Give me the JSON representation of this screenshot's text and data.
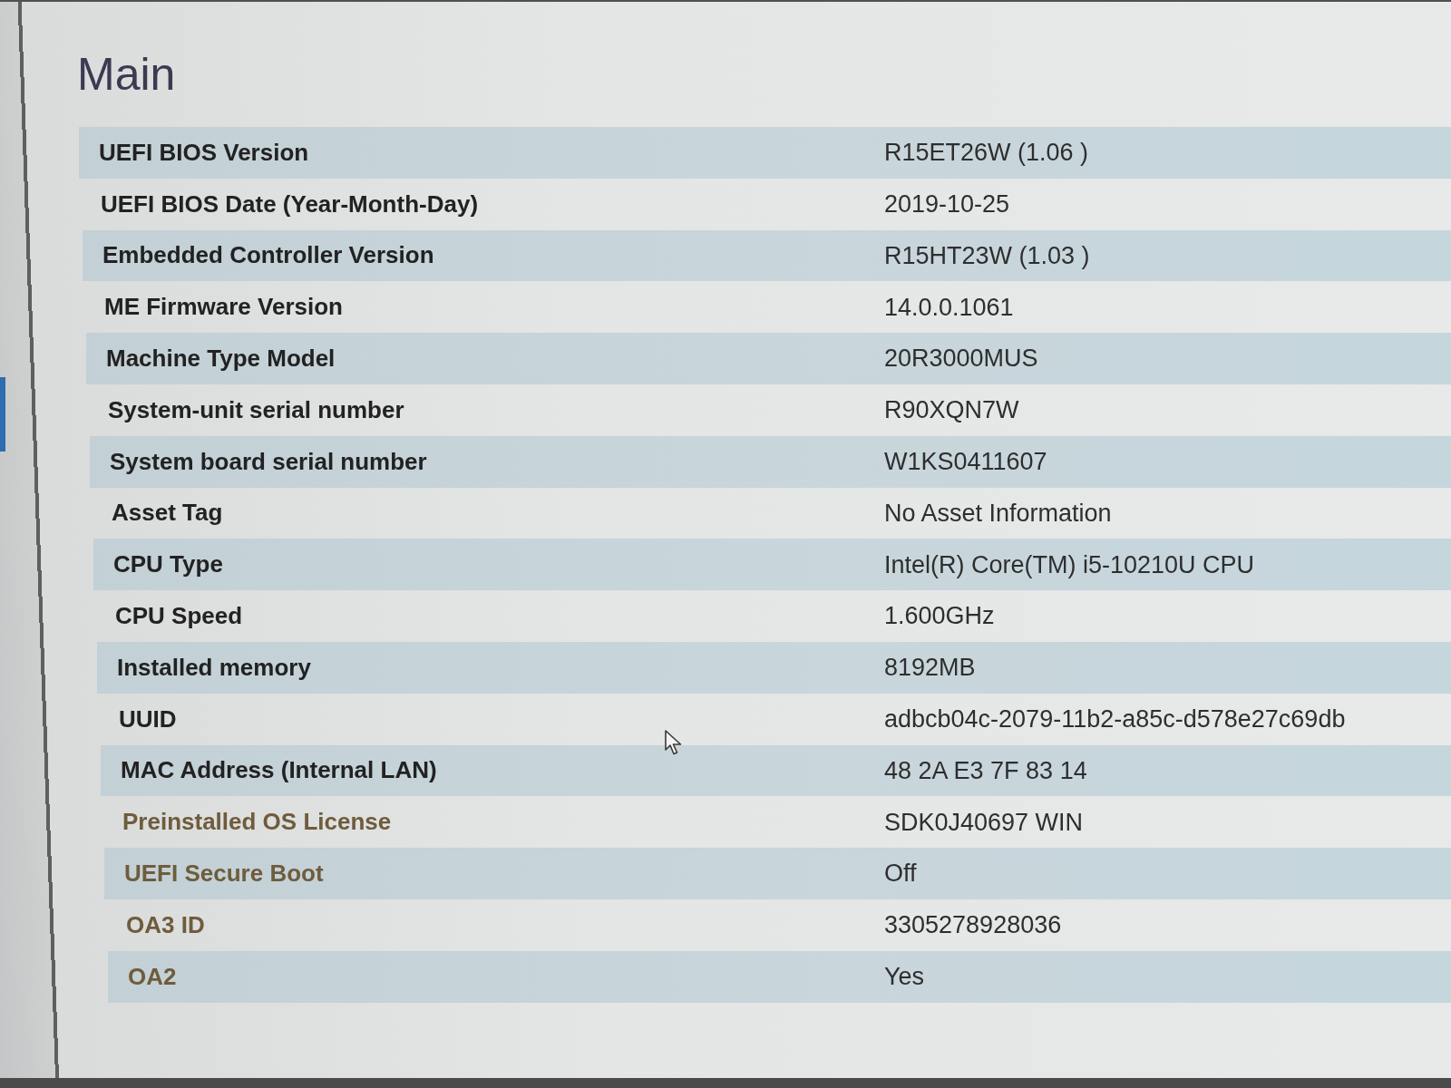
{
  "page": {
    "title": "Main"
  },
  "rows": [
    {
      "label": "UEFI BIOS Version",
      "value": "R15ET26W (1.06 )"
    },
    {
      "label": "UEFI BIOS Date (Year-Month-Day)",
      "value": "2019-10-25"
    },
    {
      "label": "Embedded Controller Version",
      "value": "R15HT23W (1.03 )"
    },
    {
      "label": "ME Firmware Version",
      "value": "14.0.0.1061"
    },
    {
      "label": "Machine Type Model",
      "value": "20R3000MUS"
    },
    {
      "label": "System-unit serial number",
      "value": "R90XQN7W"
    },
    {
      "label": "System board serial number",
      "value": "W1KS0411607"
    },
    {
      "label": "Asset Tag",
      "value": "No Asset Information"
    },
    {
      "label": "CPU Type",
      "value": "Intel(R) Core(TM) i5-10210U CPU"
    },
    {
      "label": "CPU Speed",
      "value": "1.600GHz"
    },
    {
      "label": "Installed memory",
      "value": "8192MB"
    },
    {
      "label": "UUID",
      "value": "adbcb04c-2079-11b2-a85c-d578e27c69db"
    },
    {
      "label": "MAC Address (Internal LAN)",
      "value": "48 2A E3 7F 83 14"
    },
    {
      "label": "Preinstalled OS License",
      "value": "SDK0J40697 WIN"
    },
    {
      "label": "UEFI Secure Boot",
      "value": "Off"
    },
    {
      "label": "OA3 ID",
      "value": "3305278928036"
    },
    {
      "label": "OA2",
      "value": "Yes"
    }
  ]
}
